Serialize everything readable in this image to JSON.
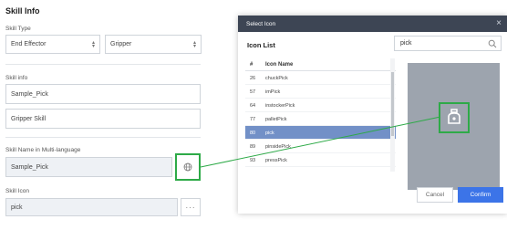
{
  "skill_panel": {
    "title": "Skill Info",
    "skill_type_label": "Skill Type",
    "skill_type_1": "End Effector",
    "skill_type_2": "Gripper",
    "skill_info_label": "Skill info",
    "skill_info_1": "Sample_Pick",
    "skill_info_2": "Gripper Skill",
    "multilang_label": "Skill Name in Multi-language",
    "multilang_value": "Sample_Pick",
    "icon_label": "Skill Icon",
    "icon_value": "pick",
    "dots_glyph": "···"
  },
  "dialog": {
    "title": "Select Icon",
    "close_glyph": "×",
    "list_title": "Icon List",
    "search_value": "pick",
    "columns": [
      "#",
      "Icon Name"
    ],
    "rows": [
      {
        "num": "26",
        "name": "chuckPick",
        "selected": false
      },
      {
        "num": "57",
        "name": "imPick",
        "selected": false
      },
      {
        "num": "64",
        "name": "instockerPick",
        "selected": false
      },
      {
        "num": "77",
        "name": "palletPick",
        "selected": false
      },
      {
        "num": "80",
        "name": "pick",
        "selected": true
      },
      {
        "num": "89",
        "name": "pinsidePick",
        "selected": false
      },
      {
        "num": "93",
        "name": "pressPick",
        "selected": false
      }
    ],
    "cancel_label": "Cancel",
    "confirm_label": "Confirm"
  },
  "colors": {
    "highlight": "#2eaa48",
    "selected_row": "#7290c7",
    "confirm": "#3c74e8",
    "dialog_header": "#3d4554"
  }
}
